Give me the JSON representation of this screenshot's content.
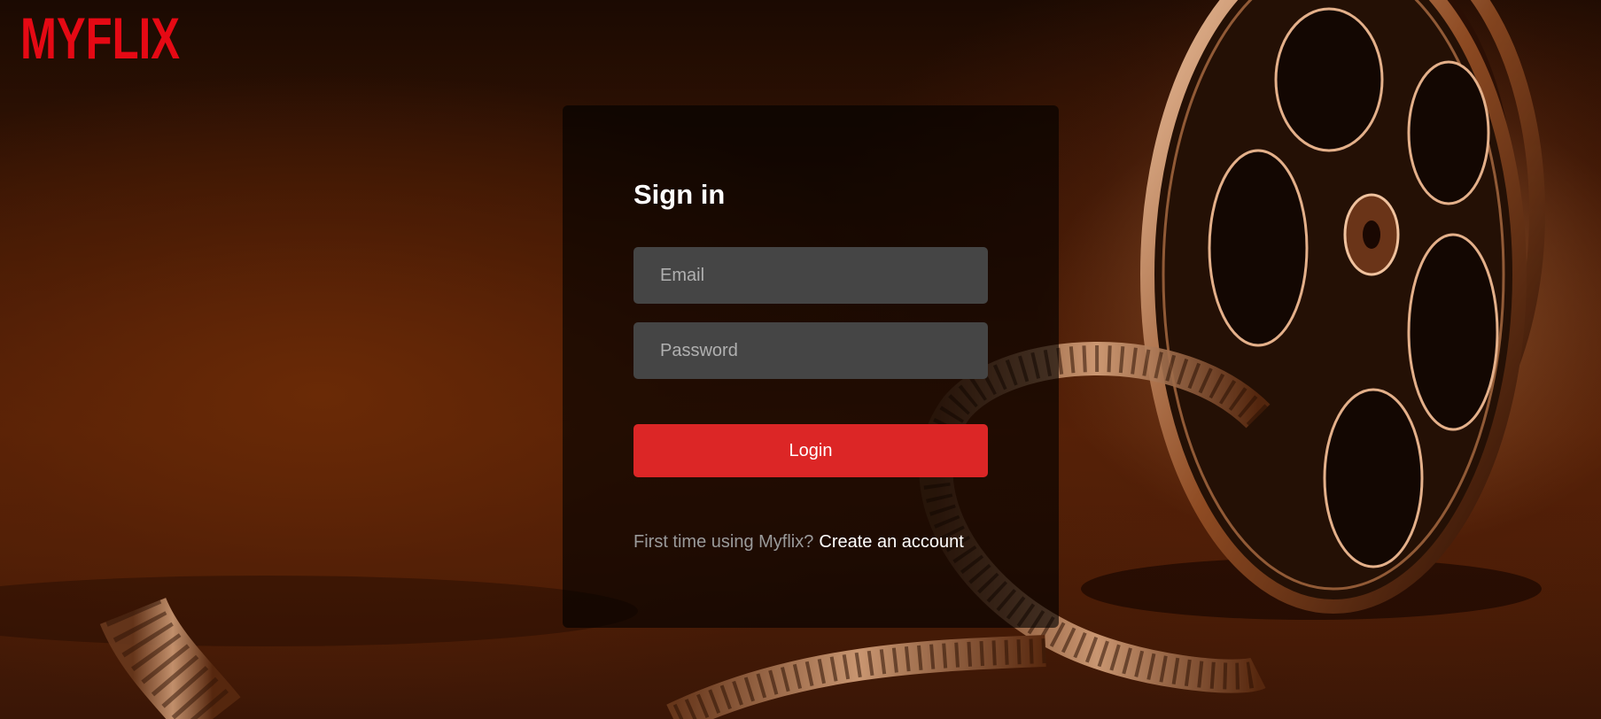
{
  "brand": {
    "logo_text": "MYFLIX",
    "logo_color": "#e50914"
  },
  "signin": {
    "title": "Sign in",
    "email_placeholder": "Email",
    "email_value": "",
    "password_placeholder": "Password",
    "password_value": "",
    "login_label": "Login",
    "signup_prompt": "First time using Myflix?",
    "signup_link": "Create an account"
  },
  "colors": {
    "accent": "#dc2626",
    "input_bg": "#454545",
    "card_bg": "rgba(0,0,0,0.62)",
    "background_tone": "#5b2306"
  }
}
